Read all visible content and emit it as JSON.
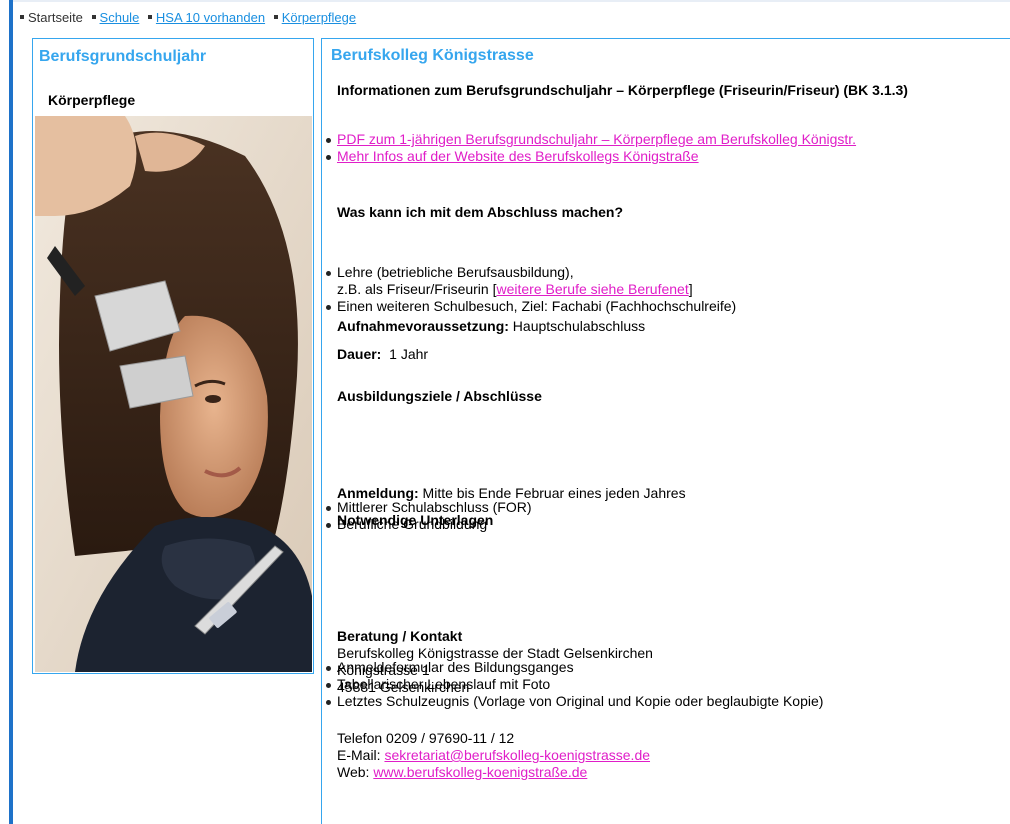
{
  "breadcrumb": {
    "items": [
      {
        "label": "Startseite",
        "link": false
      },
      {
        "label": "Schule",
        "link": true
      },
      {
        "label": "HSA 10 vorhanden",
        "link": true
      },
      {
        "label": "Körperpflege",
        "link": true
      }
    ]
  },
  "sidebar": {
    "title": "Berufsgrundschuljahr",
    "subtitle": "Körperpflege"
  },
  "main": {
    "title": "Berufskolleg Königstrasse",
    "info_heading": "Informationen zum Berufsgrundschuljahr – Körperpflege (Friseurin/Friseur) (BK 3.1.3)",
    "links": [
      "PDF zum 1-jährigen Berufsgrundschuljahr – Körperpflege am Berufskolleg Königstr.",
      "Mehr Infos auf der Website des Berufskollegs Königstraße"
    ],
    "q_heading": "Was kann ich mit dem Abschluss machen?",
    "q_item1_line1": "Lehre (betriebliche Berufsausbildung),",
    "q_item1_line2_prefix": "z.B. als Friseur/Friseurin [",
    "q_item1_link": "weitere Berufe siehe Berufenet",
    "q_item1_line2_suffix": "]",
    "q_item2": "Einen weiteren Schulbesuch, Ziel: Fachabi (Fachhochschulreife)",
    "admission_label": "Aufnahmevoraussetzung:",
    "admission_value": " Hauptschulabschluss",
    "duration_label": "Dauer:",
    "duration_value": "  1 Jahr",
    "goals_heading": "Ausbildungsziele / Abschlüsse",
    "goals": [
      "Mittlerer Schulabschluss (FOR)",
      "Berufliche Grundbildung"
    ],
    "registration_label": "Anmeldung:",
    "registration_value": " Mitte bis Ende Februar eines jeden Jahres",
    "docs_heading": "Notwendige Unterlagen",
    "docs": [
      "Anmeldeformular des Bildungsganges",
      "Tabellarischer Lebenslauf mit Foto",
      "Letztes Schulzeugnis (Vorlage von Original und Kopie oder beglaubigte Kopie)"
    ],
    "contact_heading": "Beratung / Kontakt",
    "contact_lines": [
      "Berufskolleg Königstrasse der Stadt Gelsenkirchen",
      "Königstrasse 1",
      "45881 Gelsenkirchen"
    ],
    "phone": "Telefon 0209 / 97690-11 / 12",
    "email_label": "E-Mail: ",
    "email": "sekretariat@berufskolleg-koenigstrasse.de",
    "web_label": "Web: ",
    "web": "www.berufskolleg-koenigstraße.de"
  },
  "colors": {
    "accent": "#36a6ee",
    "link_blue": "#1a8fe0",
    "link_magenta": "#e01ec8",
    "stripe": "#1e72c9"
  }
}
